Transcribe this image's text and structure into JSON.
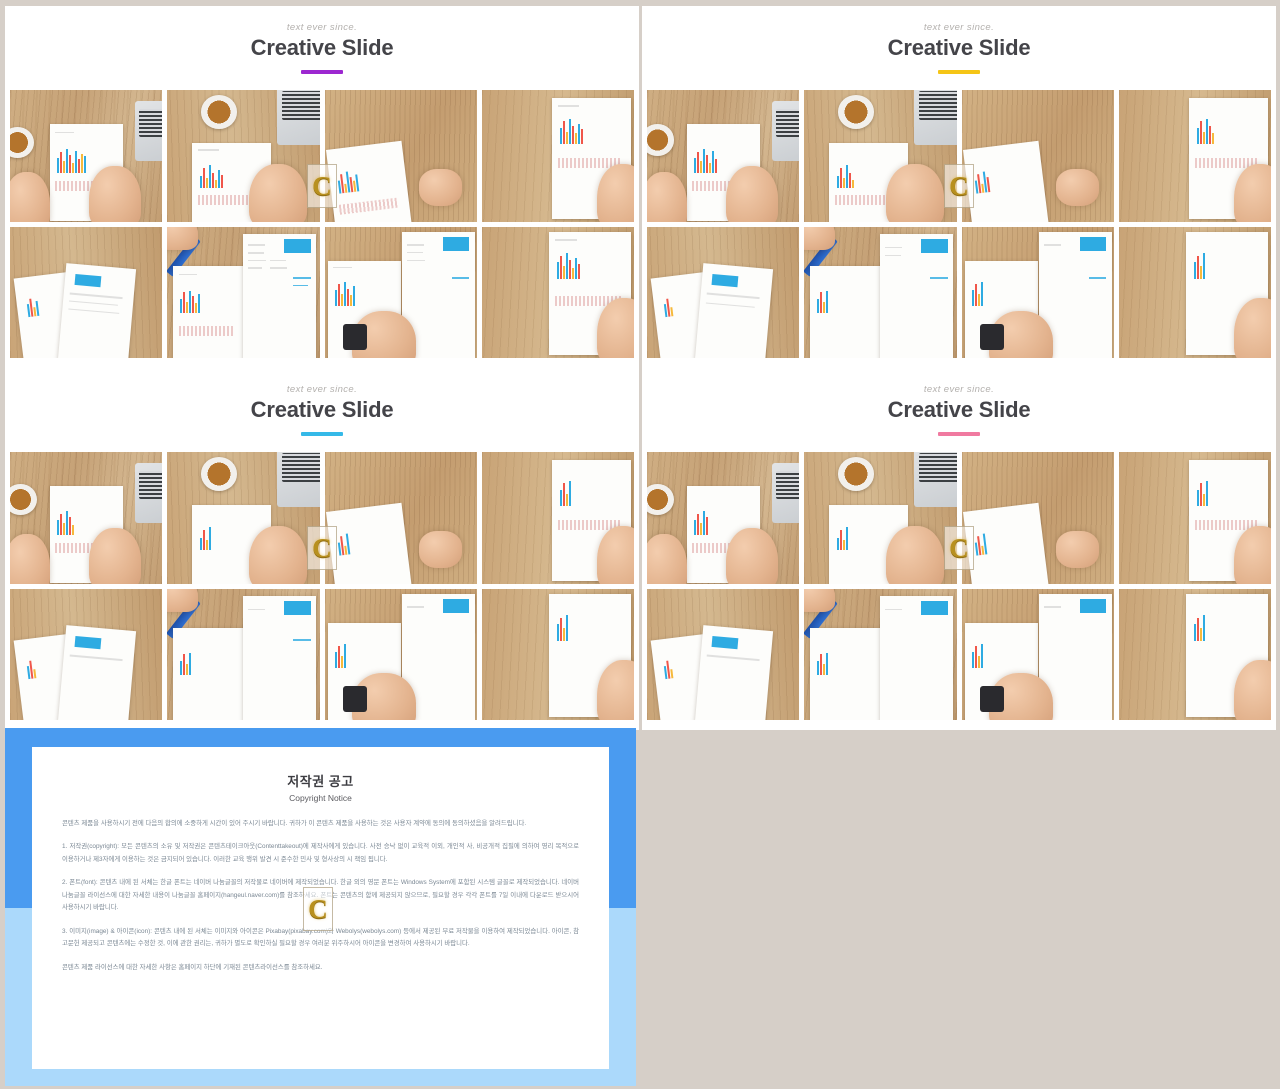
{
  "page": {
    "background_color": "#d6cfc8",
    "watermark_letter": "C",
    "watermark_color": "#b8901f"
  },
  "slides": [
    {
      "id": "slide-1",
      "eyebrow": "text ever since.",
      "title": "Creative Slide",
      "accent_color": "#9c27d0"
    },
    {
      "id": "slide-2",
      "eyebrow": "text ever since.",
      "title": "Creative Slide",
      "accent_color": "#f5c516"
    },
    {
      "id": "slide-3",
      "eyebrow": "text ever since.",
      "title": "Creative Slide",
      "accent_color": "#35b9e8"
    },
    {
      "id": "slide-4",
      "eyebrow": "text ever since.",
      "title": "Creative Slide",
      "accent_color": "#f07aa0"
    }
  ],
  "copyright_panel": {
    "panel_color_top": "#4a9bf0",
    "panel_color_bottom": "#abd9fb",
    "title": "저작권 공고",
    "subtitle": "Copyright Notice",
    "paragraphs": [
      "콘텐츠 제품을 사용하시기 전에 다음의 합의에 소중하게 시간이 있어 주시기 바랍니다. 귀하가 이 콘텐츠 제품을 사용하는 것은 사용자 계약에 동의에 동의하셨음을 알려드립니다.",
      "1. 저작권(copyright): 모든 콘텐츠의 소유 및 저작권은 콘텐츠테이크아웃(Contenttakeout)에 제작사에게 있습니다. 사전 승낙 없이 교육적 이외, 개인적 사, 비공개적 집필에 의하여 영리 목적으로 이용하거나 제3자에게 이용하는 것은 금지되어 있습니다. 이러한 교육 행위 발견 시 준수한 민사 및 형사상의 시 책임 됩니다.",
      "2. 폰트(font): 콘텐츠 내에 된 서체는 한글 폰트는 네이버 나눔글꼴의 저작물로 네이버에 제작되었습니다. 한글 외의 영문 폰트는 Windows System에 포함된 시스템 글꼴로 제작되었습니다. 네이버 나눔글꼴 라이선스에 대한 자세한 내용이 나눔글꼴 홈페이지(hangeul.naver.com)를 참조하세요. 폰트는 콘텐츠의 함께 제공되지 않으므로, 필요할 경우 각각 폰트를 7일 이내에 다운로드 받으시어 사용하시기 바랍니다.",
      "3. 이미지(image) & 아이콘(icon): 콘텐츠 내에 된 서체는 이미지와 아이콘은 Pixabay(pixabay.com)와 Webolys(webolys.com) 등에서 제공된 무료 저작물을 이용하여 제작되었습니다. 아이콘, 참고문헌 제공되고 콘텐츠에는 수정한 것, 이에 관한 권리는, 귀하가 별도로 확인하실 필요할 경우 여러분 위주하시어 아이콘을 변경하여 사용하시기 바랍니다.",
      "콘텐츠 제품 라이선스에 대한 자세한 사항은 홈페이지 하단에 기재된 콘텐츠라이선스를 참조하세요."
    ]
  }
}
